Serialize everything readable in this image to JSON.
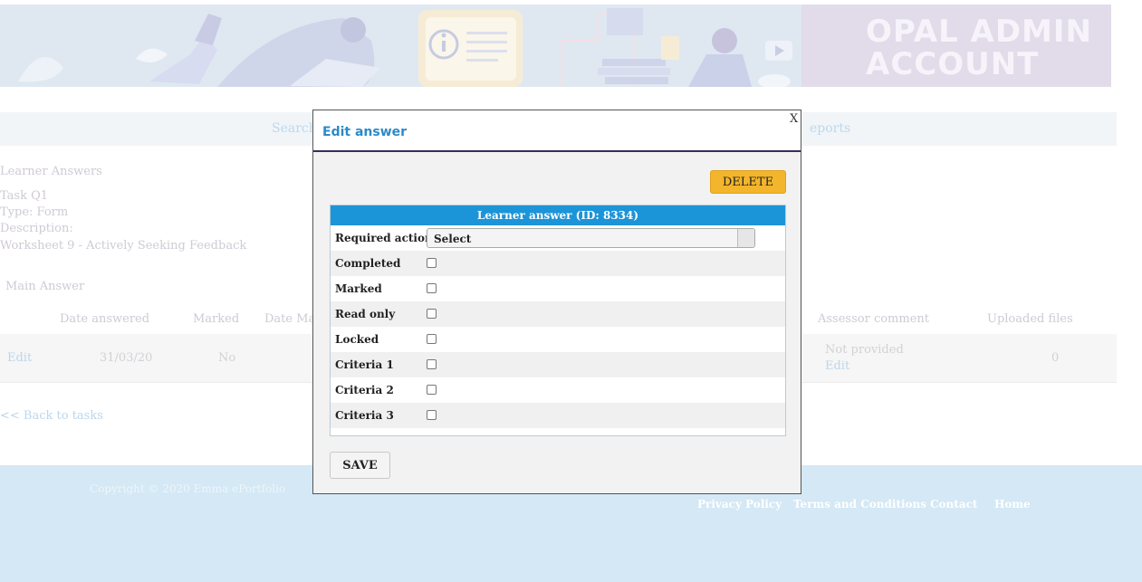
{
  "brand": {
    "title": "OPAL ADMIN ACCOUNT"
  },
  "nav": {
    "left_item": "Search",
    "right_item": "eports"
  },
  "page": {
    "heading": "Learner Answers",
    "task": "Task Q1",
    "type": "Type: Form",
    "description_label": "Description:",
    "description": "Worksheet 9 - Actively Seeking Feedback",
    "main_answer": "Main Answer",
    "back_link": "<< Back to tasks"
  },
  "table": {
    "headers": [
      "Date answered",
      "Marked",
      "Date Ma",
      "Assessor comment",
      "Uploaded files"
    ],
    "row": {
      "edit": "Edit",
      "date": "31/03/20",
      "marked": "No",
      "comment": "Not provided",
      "comment_edit": "Edit",
      "files": "0"
    }
  },
  "footer": {
    "copyright": "Copyright © 2020 Emma ePortfolio",
    "links": [
      "Privacy Policy",
      "Terms and Conditions",
      "Contact",
      "Home"
    ]
  },
  "modal": {
    "title": "Edit answer",
    "close": "X",
    "delete_label": "DELETE",
    "panel_title": "Learner answer (ID: 8334)",
    "required_action_label": "Required action",
    "required_action_value": "Select",
    "checkboxes": [
      "Completed",
      "Marked",
      "Read only",
      "Locked",
      "Criteria 1",
      "Criteria 2",
      "Criteria 3"
    ],
    "save_label": "SAVE"
  },
  "colors": {
    "accent_blue": "#1c94d8",
    "title_blue": "#2c8ac9",
    "delete_orange": "#f2b52c",
    "header_border": "#3a2a5a",
    "footer_bg": "#d4e8f5"
  }
}
